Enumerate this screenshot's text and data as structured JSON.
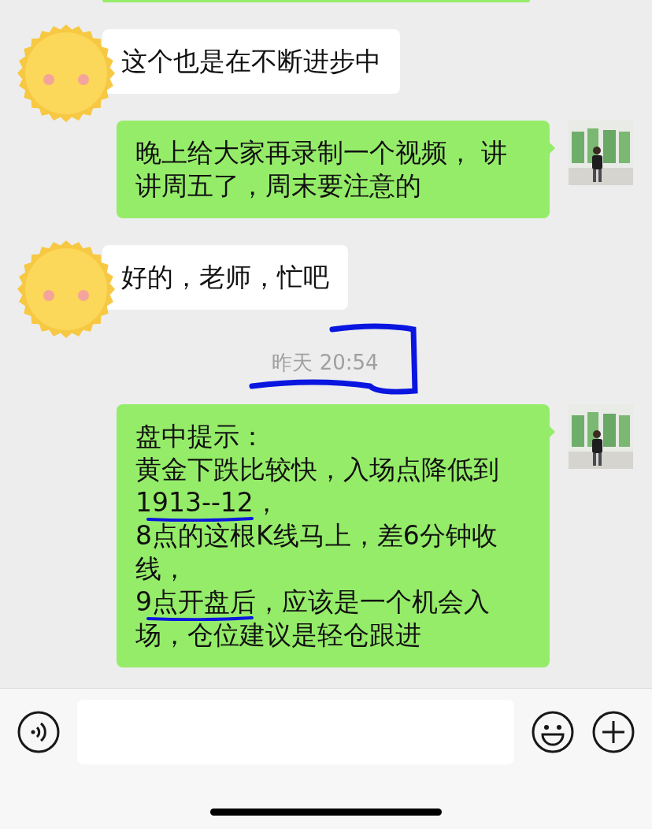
{
  "messages": [
    {
      "kind": "received",
      "lines": [
        {
          "text": "这个也是在不断进步中",
          "underlined": false
        }
      ]
    },
    {
      "kind": "sent",
      "lines": [
        {
          "text": "晚上给大家再录制一个视频，  讲",
          "underlined": false
        },
        {
          "text": "讲周五了，周末要注意的",
          "underlined": false
        }
      ]
    },
    {
      "kind": "received",
      "lines": [
        {
          "text": "好的，老师，忙吧",
          "underlined": false
        }
      ]
    },
    {
      "kind": "time",
      "text": "昨天 20:54"
    },
    {
      "kind": "sent",
      "lines": [
        {
          "text": "盘中提示：",
          "underlined": false
        },
        {
          "text": "黄金下跌比较快，入场点降低到",
          "underlined": false
        },
        {
          "text": "1913--12，",
          "underlined": true
        },
        {
          "text": "8点的这根K线马上，差6分钟收",
          "underlined": false
        },
        {
          "text": "线，",
          "underlined": false
        },
        {
          "text": "9点开盘后，应该是一个机会入",
          "underlined": true
        },
        {
          "text": "场，仓位建议是轻仓跟进",
          "underlined": false
        }
      ]
    }
  ]
}
